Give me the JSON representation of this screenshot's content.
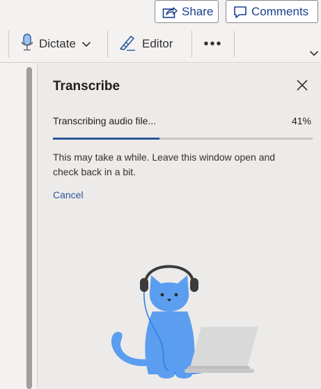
{
  "header": {
    "share_label": "Share",
    "comments_label": "Comments"
  },
  "ribbon": {
    "dictate_label": "Dictate",
    "editor_label": "Editor",
    "more_label": "•••"
  },
  "transcribe": {
    "title": "Transcribe",
    "status_text": "Transcribing audio file...",
    "progress_label": "41%",
    "progress_fraction": 0.41,
    "message": "This may take a while. Leave this window open and check back in a bit.",
    "cancel_label": "Cancel"
  },
  "colors": {
    "accent": "#2b579a",
    "cat": "#5b9ef0",
    "laptop": "#dcdcdc"
  },
  "icons": [
    "share-icon",
    "comment-icon",
    "microphone-icon",
    "chevron-down-icon",
    "editor-pen-icon",
    "close-icon"
  ]
}
